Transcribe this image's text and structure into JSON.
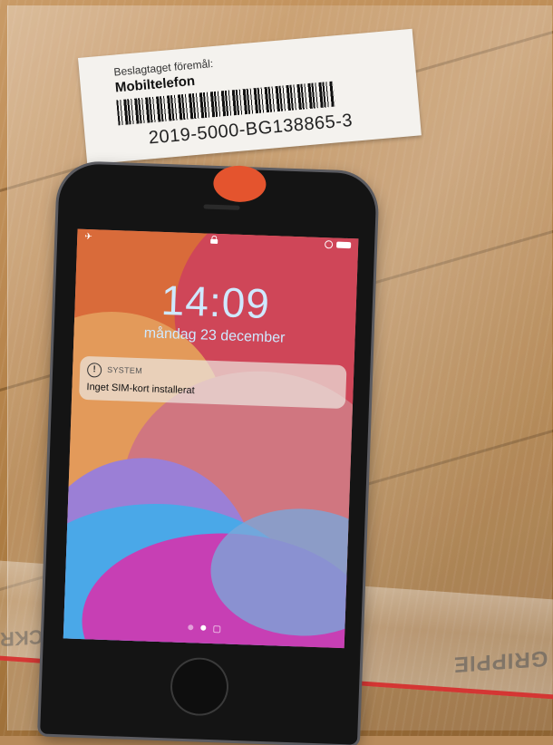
{
  "evidence_label": {
    "heading": "Beslagtaget föremål:",
    "item": "Mobiltelefon",
    "case_number": "2019-5000-BG138865-3"
  },
  "lock_screen": {
    "time": "14:09",
    "date": "måndag 23 december",
    "notification": {
      "app": "SYSTEM",
      "message": "Inget SIM-kort installerat",
      "icon": "exclamation-icon"
    },
    "status_bar": {
      "left_icon": "signal-icon",
      "center_icon": "lock-icon",
      "right_icons": [
        "alarm-icon",
        "battery-icon"
      ]
    },
    "page_dots": 3,
    "active_dot": 2
  },
  "bag": {
    "brand": "GRIPPIE",
    "brand_left": "ACKR"
  },
  "colors": {
    "sticker": "#e4542e",
    "clock": "#cfe9ff",
    "seal_line": "#d62a2a"
  }
}
